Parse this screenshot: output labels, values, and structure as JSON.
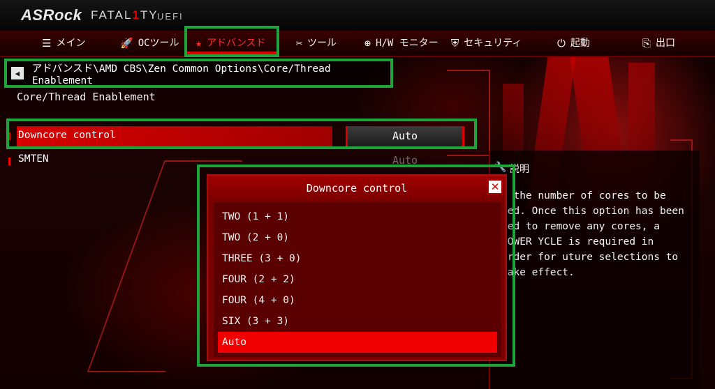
{
  "brand": {
    "asrock": "ASRock",
    "fatal_pre": "FATAL",
    "fatal_one": "1",
    "fatal_post": "TY",
    "uefi": "UEFI"
  },
  "nav": [
    {
      "label": "メイン",
      "icon": "menu-list-icon",
      "glyph": "☰",
      "active": false
    },
    {
      "label": "OCツール",
      "icon": "rocket-icon",
      "glyph": "🚀",
      "active": false
    },
    {
      "label": "アドバンスド",
      "icon": "star-icon",
      "glyph": "★",
      "active": true
    },
    {
      "label": "ツール",
      "icon": "tools-icon",
      "glyph": "✂",
      "active": false
    },
    {
      "label": "H/W モニター",
      "icon": "crosshair-icon",
      "glyph": "⊕",
      "active": false
    },
    {
      "label": "セキュリティ",
      "icon": "shield-icon",
      "glyph": "⛨",
      "active": false
    },
    {
      "label": "起動",
      "icon": "power-icon",
      "glyph": "⏻",
      "active": false
    },
    {
      "label": "出口",
      "icon": "exit-door-icon",
      "glyph": "⎘",
      "active": false
    }
  ],
  "breadcrumb": {
    "back_glyph": "◀",
    "path": "アドバンスド\\AMD CBS\\Zen Common Options\\Core/Thread Enablement"
  },
  "section_title": "Core/Thread Enablement",
  "options": [
    {
      "label": "Downcore control",
      "value": "Auto",
      "selected": true
    },
    {
      "label": "SMTEN",
      "value": "Auto",
      "selected": false
    }
  ],
  "description": {
    "title": "説明",
    "text": "s the number of cores to be sed. Once this option has been sed to remove any cores, a POWER YCLE is required in order for uture selections to take effect."
  },
  "popup": {
    "title": "Downcore control",
    "close_glyph": "✕",
    "options": [
      "TWO (1 + 1)",
      "TWO (2 + 0)",
      "THREE (3 + 0)",
      "FOUR (2 + 2)",
      "FOUR (4 + 0)",
      "SIX (3 + 3)",
      "Auto"
    ],
    "selected_index": 6
  },
  "colors": {
    "accent": "#e00000",
    "highlight_box": "#1fa43a",
    "popup_bg": "#7a0000",
    "selected_option": "#f00000"
  }
}
